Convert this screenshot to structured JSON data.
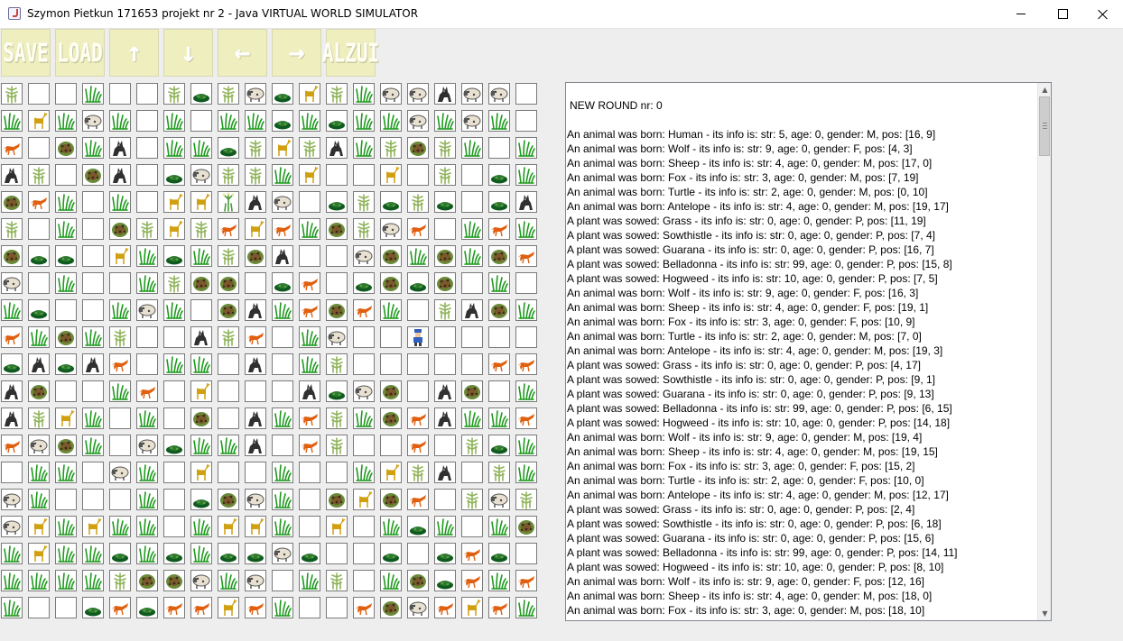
{
  "window": {
    "title": "Szymon Pietkun 171653 projekt nr 2 - Java  VIRTUAL WORLD SIMULATOR"
  },
  "toolbar": {
    "save_label": "SAVE",
    "load_label": "LOAD",
    "up_label": "↑",
    "down_label": "↓",
    "left_label": "←",
    "right_label": "→",
    "alzur_label": "ALZUI"
  },
  "board": {
    "cols": 20,
    "rows": 20,
    "legend": {
      "E": "empty",
      "G": "grass",
      "W": "wolf",
      "S": "sheep",
      "F": "fox",
      "A": "antelope",
      "T": "sowthistle",
      "U": "guarana",
      "B": "belladonna",
      "H": "hogweed",
      "P": "human"
    },
    "grid": [
      "TEEGEETUTSUATGSSWSSE",
      "GAGSGEGEGGUGUGGSGSGE",
      "FEBGWEGGUTATWGTBTGEG",
      "WTEBWEUSTTGAEEAETEUG",
      "BFGEGEAAHWSEUTUTUEUW",
      "TEGEBTATFAFGBTSFEGFG",
      "BUUEAGUGTBWEESBGBGBF",
      "SEGEEGTBBEUFEUBUBEGE",
      "GUEEGSGEBWGFBFGETWBG",
      "FGBGTEEWTFEGSEEPEEEE",
      "UWUWFEGGEWEGTEEEEEFF",
      "WBEEGFEAEEEWUSBEWBEG",
      "WTAGEGEBEWGFTGBFWGGF",
      "FSBGESUGGWEFTEEFETUG",
      "EGGESGEAEEGEEGATWETG",
      "SGEEEGEUBSGEBABFETST",
      "SAGAGGEGAAGEAEGUGEGB",
      "GAGGUGUGUUSUEEUEUFUE",
      "GGGGTBBSGSEGTEGBUFGF",
      "GEEUFUFFAFGEEFBSFAFG"
    ]
  },
  "log": {
    "lines": [
      "NEW ROUND nr: 0",
      "An animal was born: Human - its info is: str: 5, age: 0, gender: M, pos: [16, 9]",
      "An animal was born: Wolf - its info is: str: 9, age: 0, gender: F, pos: [4, 3]",
      "An animal was born: Sheep - its info is: str: 4, age: 0, gender: M, pos: [17, 0]",
      "An animal was born: Fox - its info is: str: 3, age: 0, gender: M, pos: [7, 19]",
      "An animal was born: Turtle - its info is: str: 2, age: 0, gender: M, pos: [0, 10]",
      "An animal was born: Antelope - its info is: str: 4, age: 0, gender: M, pos: [19, 17]",
      "A plant was sowed: Grass - its info is: str: 0, age: 0, gender: P, pos: [11, 19]",
      "A plant was sowed: Sowthistle - its info is: str: 0, age: 0, gender: P, pos: [7, 4]",
      "A plant was sowed: Guarana - its info is: str: 0, age: 0, gender: P, pos: [16, 7]",
      "A plant was sowed: Belladonna - its info is: str: 99, age: 0, gender: P, pos: [15, 8]",
      "A plant was sowed: Hogweed - its info is: str: 10, age: 0, gender: P, pos: [7, 5]",
      "An animal was born: Wolf - its info is: str: 9, age: 0, gender: F, pos: [16, 3]",
      "An animal was born: Sheep - its info is: str: 4, age: 0, gender: F, pos: [19, 1]",
      "An animal was born: Fox - its info is: str: 3, age: 0, gender: F, pos: [10, 9]",
      "An animal was born: Turtle - its info is: str: 2, age: 0, gender: M, pos: [7, 0]",
      "An animal was born: Antelope - its info is: str: 4, age: 0, gender: M, pos: [19, 3]",
      "A plant was sowed: Grass - its info is: str: 0, age: 0, gender: P, pos: [4, 17]",
      "A plant was sowed: Sowthistle - its info is: str: 0, age: 0, gender: P, pos: [9, 1]",
      "A plant was sowed: Guarana - its info is: str: 0, age: 0, gender: P, pos: [9, 13]",
      "A plant was sowed: Belladonna - its info is: str: 99, age: 0, gender: P, pos: [6, 15]",
      "A plant was sowed: Hogweed - its info is: str: 10, age: 0, gender: P, pos: [14, 18]",
      "An animal was born: Wolf - its info is: str: 9, age: 0, gender: M, pos: [19, 4]",
      "An animal was born: Sheep - its info is: str: 4, age: 0, gender: M, pos: [19, 15]",
      "An animal was born: Fox - its info is: str: 3, age: 0, gender: F, pos: [15, 2]",
      "An animal was born: Turtle - its info is: str: 2, age: 0, gender: F, pos: [10, 0]",
      "An animal was born: Antelope - its info is: str: 4, age: 0, gender: M, pos: [12, 17]",
      "A plant was sowed: Grass - its info is: str: 0, age: 0, gender: P, pos: [2, 4]",
      "A plant was sowed: Sowthistle - its info is: str: 0, age: 0, gender: P, pos: [6, 18]",
      "A plant was sowed: Guarana - its info is: str: 0, age: 0, gender: P, pos: [15, 6]",
      "A plant was sowed: Belladonna - its info is: str: 99, age: 0, gender: P, pos: [14, 11]",
      "A plant was sowed: Hogweed - its info is: str: 10, age: 0, gender: P, pos: [8, 10]",
      "An animal was born: Wolf - its info is: str: 9, age: 0, gender: F, pos: [12, 16]",
      "An animal was born: Sheep - its info is: str: 4, age: 0, gender: M, pos: [18, 0]",
      "An animal was born: Fox - its info is: str: 3, age: 0, gender: M, pos: [18, 10]"
    ]
  },
  "colors": {
    "toolbar_button": "#eeeebf",
    "grass": "#1f9a1f",
    "sowthistle": "#8fb35a",
    "guarana": "#0f5a1f",
    "belladonna": "#7a5a2a",
    "hogweed": "#4a9a3a",
    "wolf": "#303030",
    "sheep": "#e8e0d0",
    "fox": "#e06010",
    "antelope": "#d0a010"
  }
}
